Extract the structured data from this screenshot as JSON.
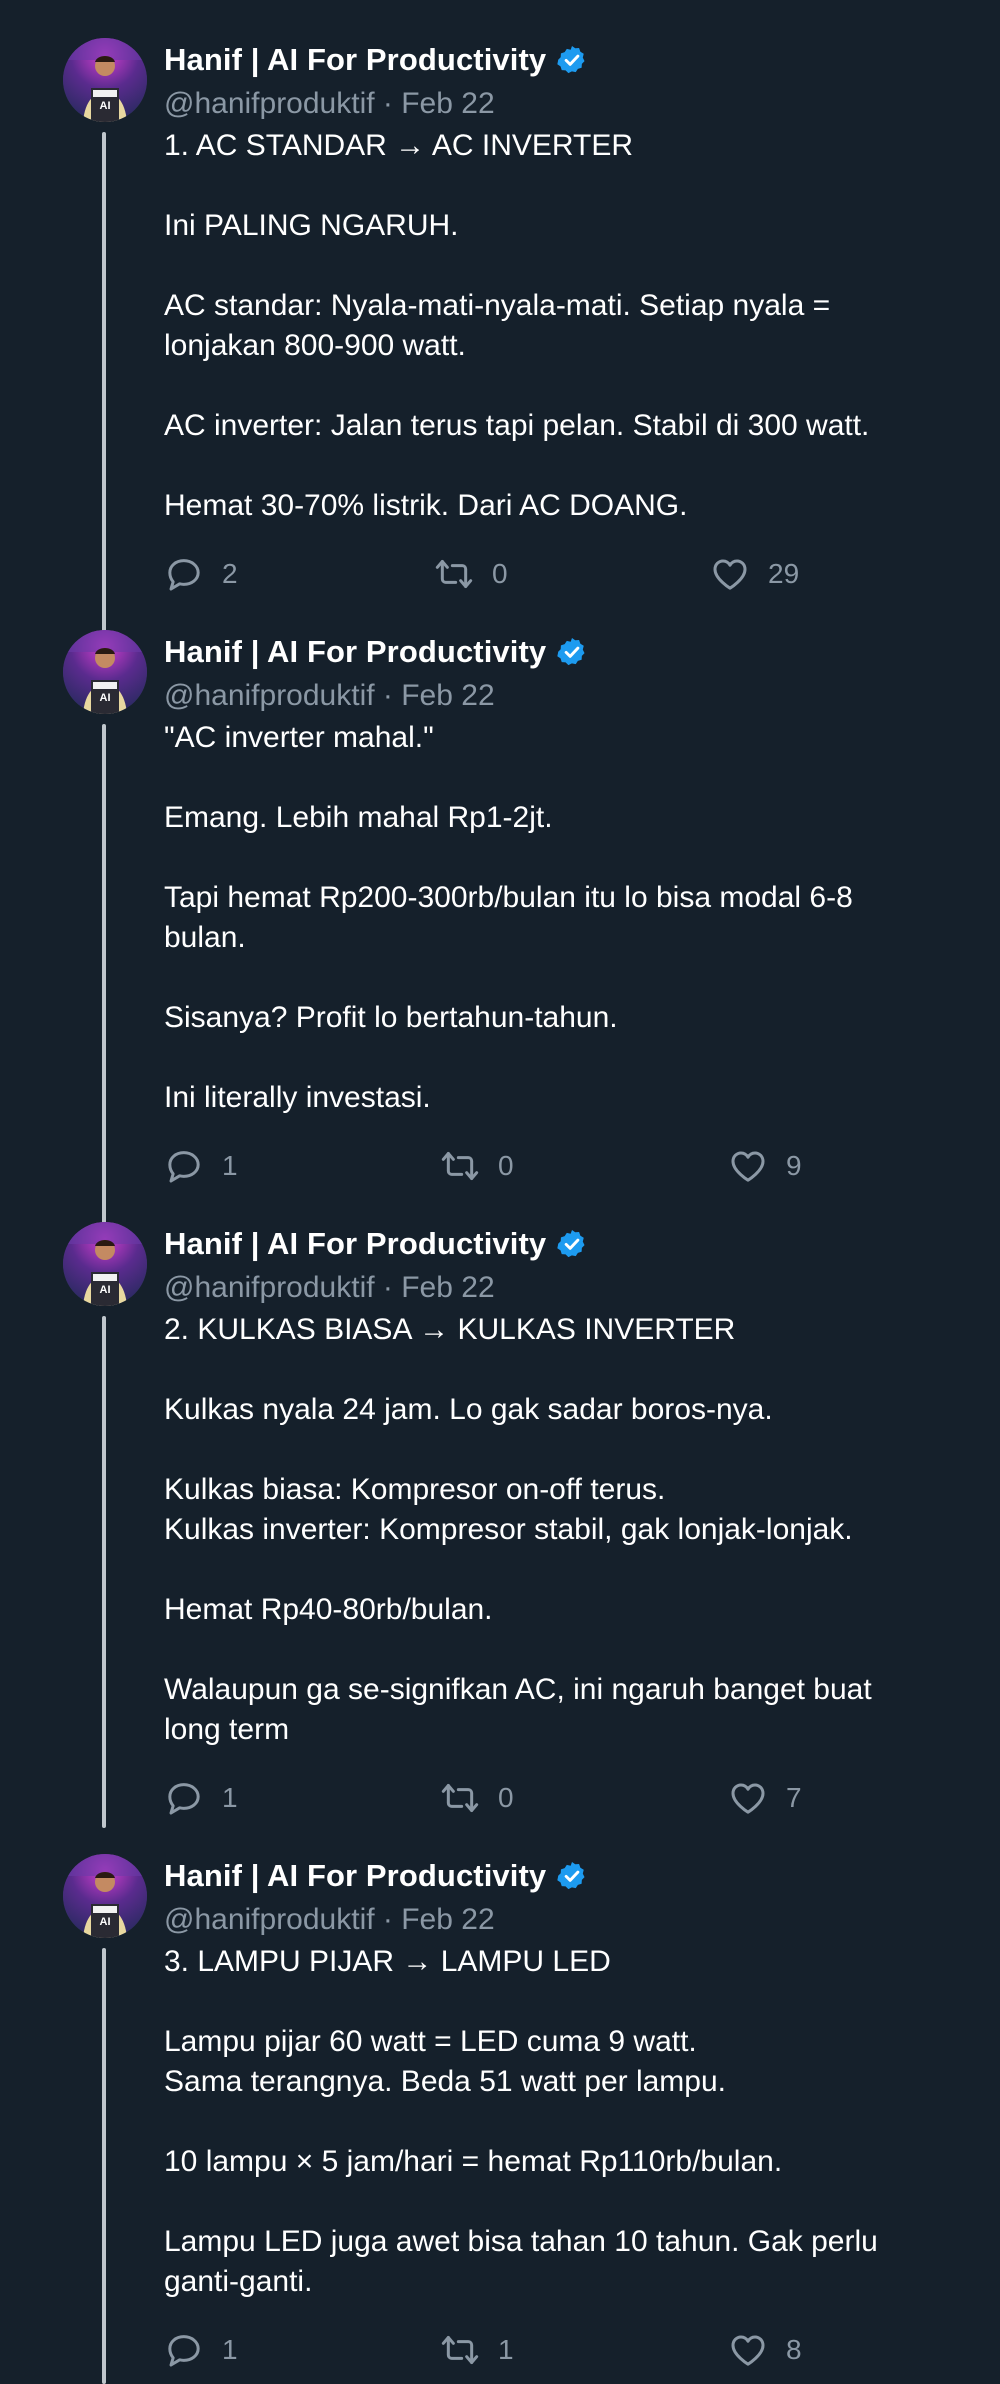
{
  "author": {
    "name": "Hanif | AI For Productivity",
    "handle_line": "@hanifproduktif · Feb 22"
  },
  "colors": {
    "background": "#15202b",
    "muted": "#8b98a5",
    "verified": "#1d9bf0",
    "thread_line": "#bfc6cc"
  },
  "icons": {
    "reply": "speech-bubble-icon",
    "retweet": "retweet-arrows-icon",
    "like": "heart-icon",
    "verified": "verified-badge-icon"
  },
  "tweets": [
    {
      "text": "1. AC STANDAR → AC INVERTER\n\nIni PALING NGARUH.\n\nAC standar: Nyala-mati-nyala-mati. Setiap nyala =\nlonjakan 800-900 watt.\n\nAC inverter: Jalan terus tapi pelan. Stabil di 300 watt.\n\nHemat 30-70% listrik. Dari AC DOANG.",
      "replies": "2",
      "retweets": "0",
      "likes": "29"
    },
    {
      "text": "\"AC inverter mahal.\"\n\nEmang. Lebih mahal Rp1-2jt.\n\nTapi hemat Rp200-300rb/bulan itu lo bisa modal 6-8\nbulan.\n\nSisanya? Profit lo bertahun-tahun.\n\nIni literally investasi.",
      "replies": "1",
      "retweets": "0",
      "likes": "9"
    },
    {
      "text": "2. KULKAS BIASA → KULKAS INVERTER\n\nKulkas nyala 24 jam. Lo gak sadar boros-nya.\n\nKulkas biasa: Kompresor on-off terus.\nKulkas inverter: Kompresor stabil, gak lonjak-lonjak.\n\nHemat Rp40-80rb/bulan.\n\nWalaupun ga se-signifkan AC, ini ngaruh banget buat\nlong term",
      "replies": "1",
      "retweets": "0",
      "likes": "7"
    },
    {
      "text": "3. LAMPU PIJAR → LAMPU LED\n\nLampu pijar 60 watt = LED cuma 9 watt.\nSama terangnya. Beda 51 watt per lampu.\n\n10 lampu × 5 jam/hari = hemat Rp110rb/bulan.\n\nLampu LED juga awet bisa tahan 10 tahun. Gak perlu\nganti-ganti.",
      "replies": "1",
      "retweets": "1",
      "likes": "8"
    }
  ]
}
